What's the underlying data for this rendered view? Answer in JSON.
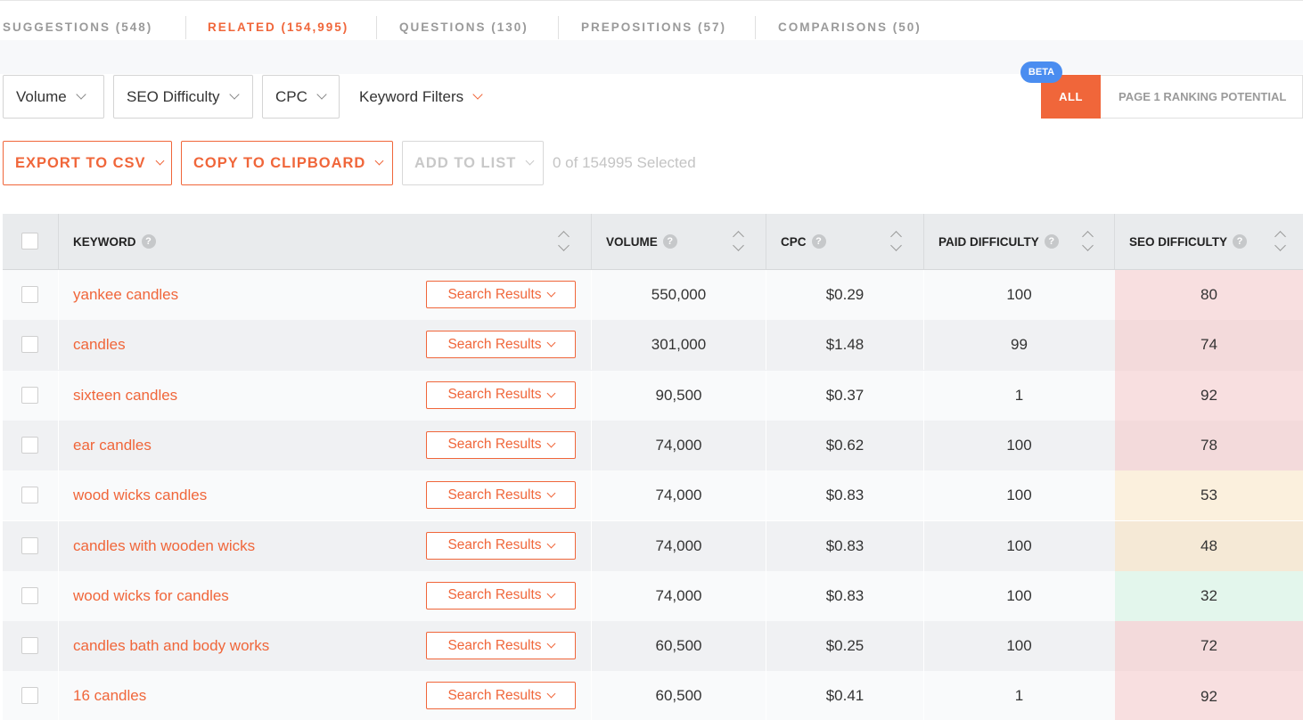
{
  "tabs": [
    {
      "label": "SUGGESTIONS (548)",
      "active": false
    },
    {
      "label": "RELATED (154,995)",
      "active": true
    },
    {
      "label": "QUESTIONS (130)",
      "active": false
    },
    {
      "label": "PREPOSITIONS (57)",
      "active": false
    },
    {
      "label": "COMPARISONS (50)",
      "active": false
    }
  ],
  "filters": {
    "volume": "Volume",
    "seo_difficulty": "SEO Difficulty",
    "cpc": "CPC",
    "keyword_filters": "Keyword Filters"
  },
  "toggle": {
    "beta": "BETA",
    "all": "ALL",
    "page1": "PAGE 1 RANKING POTENTIAL"
  },
  "actions": {
    "export": "EXPORT TO CSV",
    "copy": "COPY TO CLIPBOARD",
    "add_list": "ADD TO LIST",
    "selected": "0 of 154995 Selected"
  },
  "table": {
    "headers": {
      "keyword": "KEYWORD",
      "volume": "VOLUME",
      "cpc": "CPC",
      "paid_difficulty": "PAID DIFFICULTY",
      "seo_difficulty": "SEO DIFFICULTY"
    },
    "search_results_label": "Search Results",
    "rows": [
      {
        "keyword": "yankee candles",
        "volume": "550,000",
        "cpc": "$0.29",
        "paid": "100",
        "seo": "80",
        "seo_color": "#f8dfe0"
      },
      {
        "keyword": "candles",
        "volume": "301,000",
        "cpc": "$1.48",
        "paid": "99",
        "seo": "74",
        "seo_color": "#f3dadb"
      },
      {
        "keyword": "sixteen candles",
        "volume": "90,500",
        "cpc": "$0.37",
        "paid": "1",
        "seo": "92",
        "seo_color": "#f8dfe0"
      },
      {
        "keyword": "ear candles",
        "volume": "74,000",
        "cpc": "$0.62",
        "paid": "100",
        "seo": "78",
        "seo_color": "#f3dadb"
      },
      {
        "keyword": "wood wicks candles",
        "volume": "74,000",
        "cpc": "$0.83",
        "paid": "100",
        "seo": "53",
        "seo_color": "#fbf0dd"
      },
      {
        "keyword": "candles with wooden wicks",
        "volume": "74,000",
        "cpc": "$0.83",
        "paid": "100",
        "seo": "48",
        "seo_color": "#f5e9d6"
      },
      {
        "keyword": "wood wicks for candles",
        "volume": "74,000",
        "cpc": "$0.83",
        "paid": "100",
        "seo": "32",
        "seo_color": "#e3f6ec"
      },
      {
        "keyword": "candles bath and body works",
        "volume": "60,500",
        "cpc": "$0.25",
        "paid": "100",
        "seo": "72",
        "seo_color": "#f3dadb"
      },
      {
        "keyword": "16 candles",
        "volume": "60,500",
        "cpc": "$0.41",
        "paid": "1",
        "seo": "92",
        "seo_color": "#f8dfe0"
      }
    ]
  }
}
